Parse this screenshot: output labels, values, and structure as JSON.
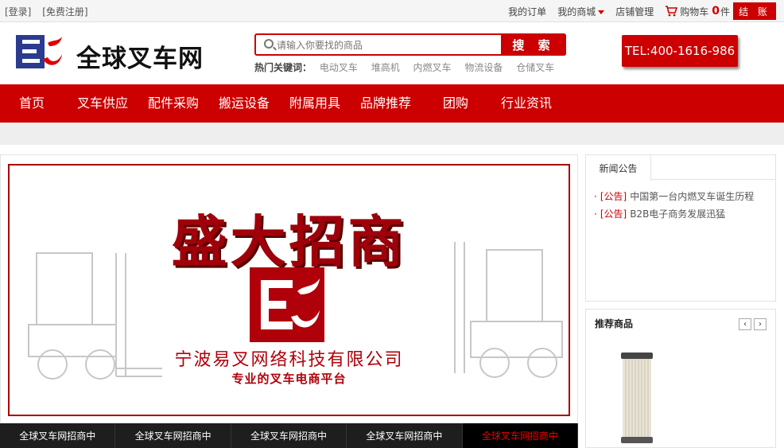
{
  "topbar": {
    "login": "[登录]",
    "register": "[免费注册]",
    "my_orders": "我的订单",
    "my_mall": "我的商城",
    "store_manage": "店铺管理",
    "cart_label": "购物车",
    "cart_count": "0",
    "cart_unit": "件",
    "checkout": "结 账"
  },
  "header": {
    "site_name": "全球叉车网",
    "search_placeholder": "请输入你要找的商品",
    "search_button": "搜 索",
    "hot_label": "热门关键词：",
    "hot_keywords": [
      "电动叉车",
      "堆高机",
      "内燃叉车",
      "物流设备",
      "仓储叉车"
    ],
    "tel": "TEL:400-1616-986"
  },
  "nav": {
    "items": [
      "首页",
      "叉车供应",
      "配件采购",
      "搬运设备",
      "附属用具",
      "品牌推荐",
      "团购",
      "行业资讯"
    ]
  },
  "banner": {
    "slogan": "盛大招商",
    "company": "宁波易叉网络科技有限公司",
    "tagline": "专业的叉车电商平台",
    "tabs": [
      "全球叉车网招商中",
      "全球叉车网招商中",
      "全球叉车网招商中",
      "全球叉车网招商中",
      "全球叉车网招商中"
    ],
    "active_tab": 4
  },
  "news": {
    "title": "新闻公告",
    "items": [
      {
        "tag": "[公告]",
        "text": "中国第一台内燃叉车诞生历程"
      },
      {
        "tag": "[公告]",
        "text": "B2B电子商务发展迅猛"
      }
    ]
  },
  "recommend": {
    "title": "推荐商品",
    "prev": "‹",
    "next": "›"
  },
  "colors": {
    "brand_red": "#cc0000",
    "dark_red": "#a0000a"
  }
}
